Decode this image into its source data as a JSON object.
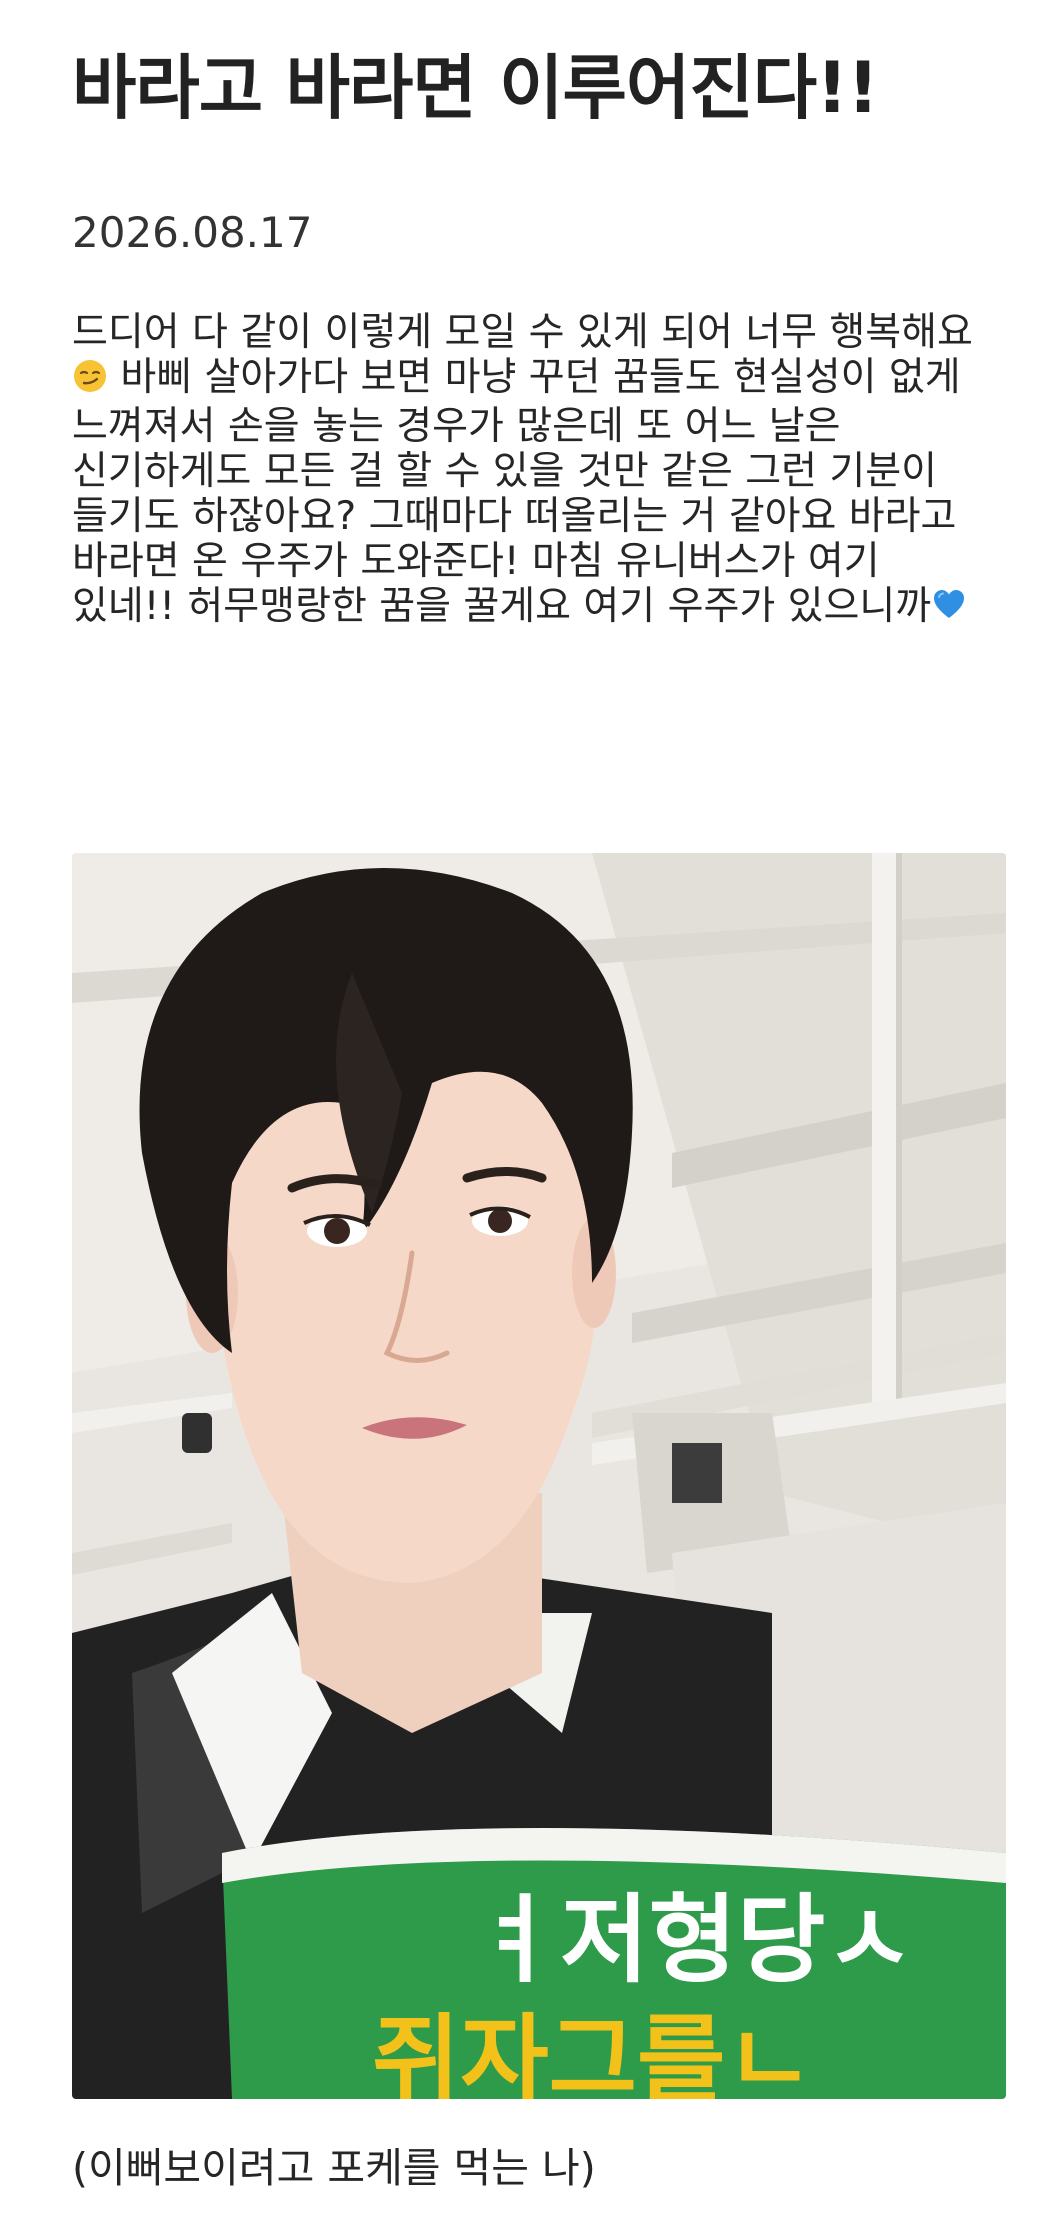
{
  "post": {
    "title": "바라고 바라면 이루어진다!!",
    "date": "2026.08.17",
    "body_parts": [
      "드디어 다 같이 이렇게 모일 수 있게 되어 너무 행복해요",
      " 바삐 살아가다 보면 마냥 꾸던 꿈들도 현실성이 없게 느껴져서 손을 놓는 경우가 많은데 또 어느 날은 신기하게도 모든 걸 할 수 있을 것만 같은 그런 기분이 들기도 하잖아요? 그때마다 떠올리는 거 같아요 바라고 바라면 온 우주가 도와준다! 마침 유니버스가 여기 있네!! 허무맹랑한 꿈을 꿀게요 여기 우주가 있으니까"
    ],
    "emoji_1": "smirking-face-emoji",
    "emoji_2": "blue-heart-emoji",
    "photo": {
      "description_icon": "selfie-photo",
      "cup_text_line1": "ㅕ저형당ㅅ",
      "cup_text_line2": "쥐자그를ㄴ",
      "cup_color": "#2e9b4a",
      "cup_text1_color": "#ffffff",
      "cup_text2_color": "#f2c21b"
    },
    "caption": "(이뻐보이려고 포케를 먹는 나)"
  }
}
